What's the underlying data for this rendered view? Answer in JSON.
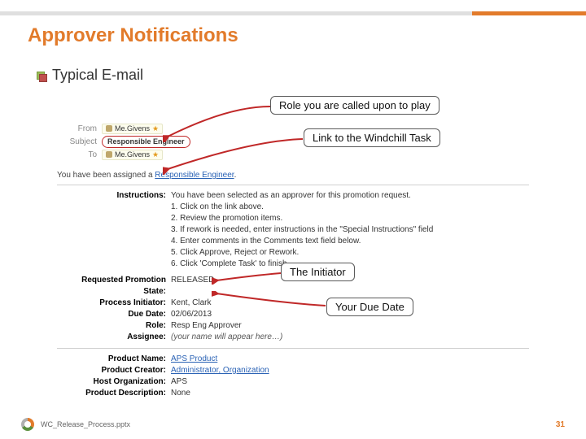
{
  "title": "Approver Notifications",
  "bullet": "Typical E-mail",
  "email": {
    "from_label": "From",
    "from_value": "Me.Givens",
    "subject_label": "Subject",
    "subject_value": "Responsible Engineer",
    "to_label": "To",
    "to_value": "Me.Givens",
    "assigned_prefix": "You have been assigned a ",
    "assigned_role": "Responsible Engineer",
    "assigned_suffix": ".",
    "labels": {
      "instructions": "Instructions:",
      "state": "Requested Promotion State:",
      "initiator": "Process Initiator:",
      "due": "Due Date:",
      "role": "Role:",
      "assignee": "Assignee:",
      "product_name": "Product Name:",
      "product_creator": "Product Creator:",
      "host_org": "Host Organization:",
      "product_desc": "Product Description:"
    },
    "instructions": "You have been selected as an approver for this promotion request.\n1. Click on the link above.\n2. Review the promotion items.\n3. If rework is needed, enter instructions in the \"Special Instructions\" field\n4. Enter comments in the Comments text field below.\n5. Click Approve, Reject or Rework.\n6. Click 'Complete Task' to finish.",
    "state": "RELEASED",
    "initiator": "Kent, Clark",
    "due": "02/06/2013",
    "role": "Resp Eng Approver",
    "assignee_note": "(your name will appear here…)",
    "product_name": "APS Product",
    "product_creator": "Administrator, Organization",
    "host_org": "APS",
    "product_desc": "None"
  },
  "callouts": {
    "role": "Role you are called upon to play",
    "link": "Link to the Windchill Task",
    "initiator": "The Initiator",
    "due": "Your Due Date"
  },
  "footer": {
    "filename": "WC_Release_Process.pptx",
    "page": "31"
  }
}
